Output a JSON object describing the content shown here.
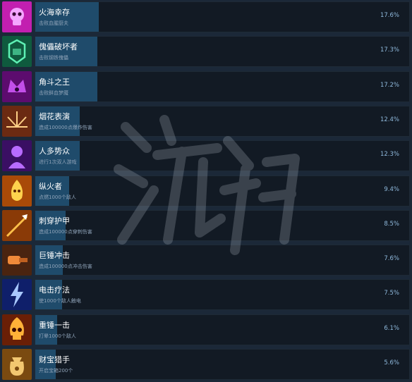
{
  "achievements": [
    {
      "title": "火海幸存",
      "desc": "击败血腥厨夫",
      "percent": "17.6%",
      "fill": 17.6,
      "icon": "purple-skull-icon",
      "icon_bg": "#c21fb0",
      "icon_fg": "#f4a6ff"
    },
    {
      "title": "傀儡破坏者",
      "desc": "击败钢铁傀儡",
      "percent": "17.3%",
      "fill": 17.3,
      "icon": "green-golem-head-icon",
      "icon_bg": "#0f5a3e",
      "icon_fg": "#5ef0b4"
    },
    {
      "title": "角斗之王",
      "desc": "击败鲜血梦魇",
      "percent": "17.2%",
      "fill": 17.2,
      "icon": "purple-crown-icon",
      "icon_bg": "#5c0c6e",
      "icon_fg": "#d35cff"
    },
    {
      "title": "烟花表演",
      "desc": "造成100000点爆炸伤害",
      "percent": "12.4%",
      "fill": 12.4,
      "icon": "firework-burst-icon",
      "icon_bg": "#6b2a12",
      "icon_fg": "#ffcf86"
    },
    {
      "title": "人多势众",
      "desc": "进行1次双人游戏",
      "percent": "12.3%",
      "fill": 12.3,
      "icon": "purple-figure-icon",
      "icon_bg": "#3a0f63",
      "icon_fg": "#b86bff"
    },
    {
      "title": "纵火者",
      "desc": "点燃1000个敌人",
      "percent": "9.4%",
      "fill": 9.4,
      "icon": "fire-monster-icon",
      "icon_bg": "#a94a08",
      "icon_fg": "#ffd24d"
    },
    {
      "title": "刺穿护甲",
      "desc": "造成100000点穿刺伤害",
      "percent": "8.5%",
      "fill": 8.5,
      "icon": "spear-streak-icon",
      "icon_bg": "#8a3a07",
      "icon_fg": "#ffc04a"
    },
    {
      "title": "巨锤冲击",
      "desc": "造成100000点冲击伤害",
      "percent": "7.6%",
      "fill": 7.6,
      "icon": "hammer-fist-icon",
      "icon_bg": "#4a2410",
      "icon_fg": "#f08a3a"
    },
    {
      "title": "电击疗法",
      "desc": "使1000个敌人触电",
      "percent": "7.5%",
      "fill": 7.5,
      "icon": "lightning-icon",
      "icon_bg": "#0f1f6a",
      "icon_fg": "#a8c8ff"
    },
    {
      "title": "重锤一击",
      "desc": "打晕1000个敌人",
      "percent": "6.1%",
      "fill": 6.1,
      "icon": "flaming-skull-icon",
      "icon_bg": "#6a1f06",
      "icon_fg": "#ffb238"
    },
    {
      "title": "财宝猎手",
      "desc": "开启宝箱200个",
      "percent": "5.6%",
      "fill": 5.6,
      "icon": "treasure-bag-icon",
      "icon_bg": "#7a4a10",
      "icon_fg": "#f2c770"
    }
  ],
  "colors": {
    "page_bg": "#1b2838",
    "card_bg": "#121a24",
    "progress_fill": "#1f4b6b",
    "title_text": "#ffffff",
    "desc_text": "#8fa3b8",
    "percent_text": "#8fb9dc"
  }
}
